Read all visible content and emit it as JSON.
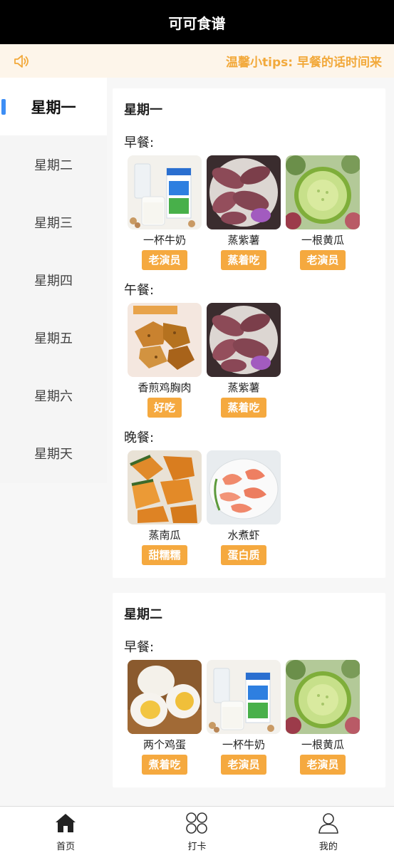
{
  "app": {
    "title": "可可食谱"
  },
  "notice": {
    "icon": "speaker-icon",
    "text": "温馨小tips: 早餐的话时间来"
  },
  "sidebar": {
    "items": [
      {
        "label": "星期一",
        "active": true
      },
      {
        "label": "星期二"
      },
      {
        "label": "星期三"
      },
      {
        "label": "星期四"
      },
      {
        "label": "星期五"
      },
      {
        "label": "星期六"
      },
      {
        "label": "星期天"
      }
    ]
  },
  "days": [
    {
      "title": "星期一",
      "meals": [
        {
          "title": "早餐:",
          "foods": [
            {
              "name": "一杯牛奶",
              "tag": "老演员",
              "image": "milk"
            },
            {
              "name": "蒸紫薯",
              "tag": "蒸着吃",
              "image": "purple-sweet-potato"
            },
            {
              "name": "一根黄瓜",
              "tag": "老演员",
              "image": "cucumber"
            }
          ]
        },
        {
          "title": "午餐:",
          "foods": [
            {
              "name": "香煎鸡胸肉",
              "tag": "好吃",
              "image": "chicken-breast"
            },
            {
              "name": "蒸紫薯",
              "tag": "蒸着吃",
              "image": "purple-sweet-potato"
            }
          ]
        },
        {
          "title": "晚餐:",
          "foods": [
            {
              "name": "蒸南瓜",
              "tag": "甜糯糯",
              "image": "pumpkin"
            },
            {
              "name": "水煮虾",
              "tag": "蛋白质",
              "image": "shrimp"
            }
          ]
        }
      ]
    },
    {
      "title": "星期二",
      "meals": [
        {
          "title": "早餐:",
          "foods": [
            {
              "name": "两个鸡蛋",
              "tag": "煮着吃",
              "image": "boiled-eggs"
            },
            {
              "name": "一杯牛奶",
              "tag": "老演员",
              "image": "milk"
            },
            {
              "name": "一根黄瓜",
              "tag": "老演员",
              "image": "cucumber"
            }
          ]
        }
      ]
    }
  ],
  "tabbar": {
    "items": [
      {
        "label": "首页",
        "icon": "home-icon",
        "active": true
      },
      {
        "label": "打卡",
        "icon": "grid-icon"
      },
      {
        "label": "我的",
        "icon": "user-icon"
      }
    ]
  },
  "colors": {
    "accent": "#f5a93f",
    "notice_text": "#f2a93b",
    "active_bar": "#3d8ef5"
  }
}
